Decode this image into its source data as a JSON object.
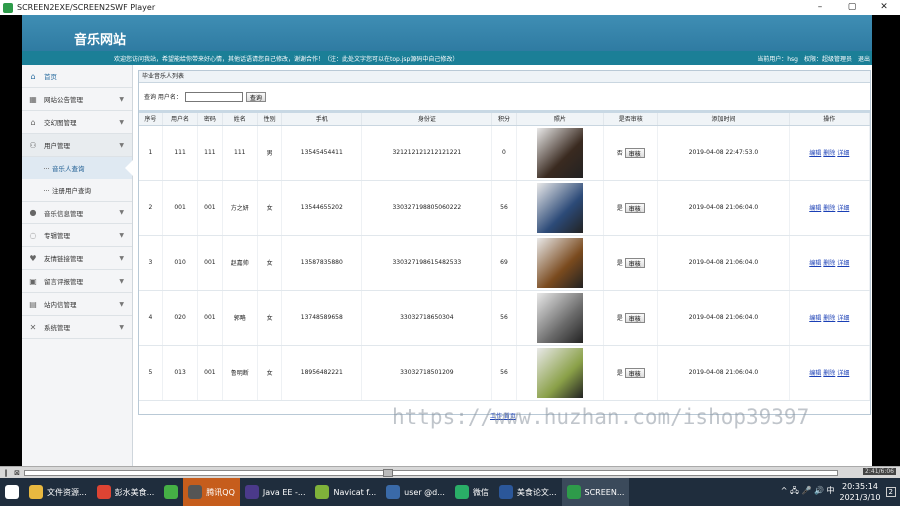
{
  "window": {
    "title": "SCREEN2EXE/SCREEN2SWF Player",
    "ctrl_min": "–",
    "ctrl_max": "▢",
    "ctrl_close": "✕"
  },
  "banner": {
    "site_title": "音乐网站"
  },
  "infobar": {
    "welcome": "欢迎您访问我站，希望能给你带来好心情，其他话语请您自己修改，谢谢合作！（注：此处文字您可以在top.jsp源码中自己修改）",
    "current_user": "当前用户：hsg",
    "role": "权限：超级管理员",
    "logout": "退出"
  },
  "sidebar": {
    "items": [
      {
        "label": "首页",
        "icon": "home-icon",
        "glyph": "⌂"
      },
      {
        "label": "网站公告管理",
        "icon": "grid-icon",
        "glyph": "▦"
      },
      {
        "label": "交幻图管理",
        "icon": "hat-icon",
        "glyph": "⌂"
      },
      {
        "label": "用户管理",
        "icon": "users-icon",
        "glyph": "⚇"
      }
    ],
    "sub_items": [
      {
        "label": "音乐人查询"
      },
      {
        "label": "注册用户查询"
      }
    ],
    "more_items": [
      {
        "label": "音乐信息管理",
        "icon": "person-icon",
        "glyph": "●"
      },
      {
        "label": "专辑管理",
        "icon": "chat-icon",
        "glyph": "◌"
      },
      {
        "label": "友情链接管理",
        "icon": "heart-icon",
        "glyph": "♥"
      },
      {
        "label": "留言评报管理",
        "icon": "calendar-icon",
        "glyph": "▣"
      },
      {
        "label": "站内信管理",
        "icon": "doc-icon",
        "glyph": "▤"
      },
      {
        "label": "系统管理",
        "icon": "tools-icon",
        "glyph": "✕"
      }
    ]
  },
  "content": {
    "crumb": "毕业音乐人列表",
    "search_label": "查询 用户名：",
    "search_value": "",
    "search_button": "查询",
    "headers": [
      "序号",
      "用户名",
      "密码",
      "姓名",
      "性别",
      "手机",
      "身份证",
      "积分",
      "照片",
      "是否审核",
      "添加时间",
      "操作"
    ],
    "rows": [
      {
        "no": "1",
        "username": "111",
        "password": "111",
        "name": "111",
        "gender": "男",
        "phone": "13545454411",
        "idcard": "321212121212121221",
        "points": "0",
        "photo_color": "#3a2a20",
        "review": "否",
        "review_btn": "审核",
        "time": "2019-04-08 22:47:53.0"
      },
      {
        "no": "2",
        "username": "001",
        "password": "001",
        "name": "方之妍",
        "gender": "女",
        "phone": "13544655202",
        "idcard": "330327198805060222",
        "points": "56",
        "photo_color": "#2c4a78",
        "review": "是",
        "review_btn": "审核",
        "time": "2019-04-08 21:06:04.0"
      },
      {
        "no": "3",
        "username": "010",
        "password": "001",
        "name": "赵嘉帅",
        "gender": "女",
        "phone": "13587835880",
        "idcard": "330327198615482533",
        "points": "69",
        "photo_color": "#7a4a1e",
        "review": "是",
        "review_btn": "审核",
        "time": "2019-04-08 21:06:04.0"
      },
      {
        "no": "4",
        "username": "020",
        "password": "001",
        "name": "郭略",
        "gender": "女",
        "phone": "13748589658",
        "idcard": "33032718650304",
        "points": "56",
        "photo_color": "#6b6b6b",
        "review": "是",
        "review_btn": "审核",
        "time": "2019-04-08 21:06:04.0"
      },
      {
        "no": "5",
        "username": "013",
        "password": "001",
        "name": "鲁明断",
        "gender": "女",
        "phone": "18956482221",
        "idcard": "33032718501209",
        "points": "56",
        "photo_color": "#8aa048",
        "review": "是",
        "review_btn": "审核",
        "time": "2019-04-08 21:06:04.0"
      }
    ],
    "actions": [
      "编辑",
      "删除",
      "详细"
    ],
    "footer_link": "工作·首页"
  },
  "watermark": "https://www.huzhan.com/ishop39397",
  "player": {
    "play": "‖",
    "stop": "⊠",
    "time": "2:41/6:06"
  },
  "taskbar": {
    "items": [
      {
        "label": "",
        "color": "#ffffff",
        "icon": "windows-start-icon"
      },
      {
        "label": "文件资源...",
        "color": "#e8b840",
        "icon": "folder-icon"
      },
      {
        "label": "彭水美食...",
        "color": "#dd4433",
        "icon": "chrome-icon"
      },
      {
        "label": "",
        "color": "#45b045",
        "icon": "green-app-icon"
      },
      {
        "label": "腾讯QQ",
        "color": "#555555",
        "icon": "qq-icon"
      },
      {
        "label": "Java EE -...",
        "color": "#4b3a8a",
        "icon": "eclipse-icon"
      },
      {
        "label": "Navicat f...",
        "color": "#7fb23a",
        "icon": "navicat-icon"
      },
      {
        "label": "user @d...",
        "color": "#3a6aa8",
        "icon": "db-icon"
      },
      {
        "label": "微信",
        "color": "#2aae67",
        "icon": "wechat-icon"
      },
      {
        "label": "美食论文...",
        "color": "#2b579a",
        "icon": "word-icon"
      },
      {
        "label": "SCREEN...",
        "color": "#2e9b4a",
        "icon": "screen2exe-icon"
      }
    ],
    "tray": "^ 🖧 🎤 🔊 中",
    "time": "20:35:14",
    "date": "2021/3/10",
    "notify": "2"
  }
}
